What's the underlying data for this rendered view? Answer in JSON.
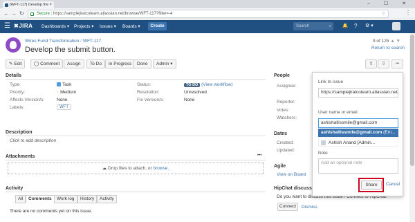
{
  "browser": {
    "tab_title": "[WFT-117] Develop the",
    "tab_close": "×",
    "window_controls": "– ☐ ✕",
    "secure_label": "Secure",
    "url": "https://samplejiratcolearn.atlassian.net/browse/WFT-117?filter=-4",
    "star": "☆",
    "menu": "⋮",
    "back": "←",
    "forward": "→",
    "reload": "↻"
  },
  "topnav": {
    "menu_glyph": "☰",
    "logo": "✖JIRA",
    "items": [
      "Dashboards ▾",
      "Projects ▾",
      "Issues ▾",
      "Boards ▾"
    ],
    "create": "Create",
    "search_placeholder": "Search",
    "search_icon": "⌕",
    "bell": "🔔",
    "help": "?",
    "settings": "⚙ ▾",
    "accent": "#205081"
  },
  "issue": {
    "project": "Wires Fund Transformation",
    "separator": "/",
    "key": "WFT-117",
    "summary": "Develop the submit button.",
    "pager": "9 of 125",
    "pager_arrows": "▲ ▼",
    "return_link": "Return to search"
  },
  "toolbar": {
    "edit": "✎ Edit",
    "comment": "◯ Comment",
    "assign": "Assign",
    "todo": "To Do",
    "in_progress": "In Progress",
    "done": "Done",
    "admin": "Admin ▾",
    "share_icon": "⇪",
    "export_icon": "⇩",
    "more_icon": "•••"
  },
  "details": {
    "heading": "Details",
    "type_label": "Type:",
    "type_value": "Task",
    "priority_label": "Priority:",
    "priority_value": "Medium",
    "priority_icon": "↑",
    "affects_label": "Affects Version/s:",
    "affects_value": "None",
    "labels_label": "Labels:",
    "labels_value": "WFT",
    "status_label": "Status:",
    "status_value": "TO DO",
    "workflow_link": "(View workflow)",
    "resolution_label": "Resolution:",
    "resolution_value": "Unresolved",
    "fix_label": "Fix Version/s:",
    "fix_value": "None"
  },
  "description": {
    "heading": "Description",
    "placeholder": "Click to add description"
  },
  "attachments": {
    "heading": "Attachments",
    "more": "•••",
    "drop_text": "Drop files to attach, or",
    "browse": "browse."
  },
  "activity": {
    "heading": "Activity",
    "tabs": [
      "All",
      "Comments",
      "Work log",
      "History",
      "Activity"
    ],
    "active_tab": "Comments",
    "empty": "There are no comments yet on this issue."
  },
  "people": {
    "heading": "People",
    "assignee_label": "Assignee:",
    "reporter_label": "Reporter:",
    "votes_label": "Votes:",
    "watchers_label": "Watchers:"
  },
  "dates": {
    "heading": "Dates",
    "created_label": "Created:",
    "updated_label": "Updated:"
  },
  "agile": {
    "heading": "Agile",
    "link": "View on Board"
  },
  "hipchat": {
    "heading": "HipChat discussio",
    "text": "Do you want to discuss this issue? Connect to HipChat.",
    "connect": "Connect",
    "dismiss": "Dismiss"
  },
  "share_popup": {
    "link_label": "Link to issue",
    "link_value": "https://samplejiratcolearn.atlassian.net/b",
    "user_label": "User name or email",
    "user_value": "ashishallissmile@gmail.com",
    "suggestion_1_bold": "ashishallissmile@gmail.com",
    "suggestion_1_rest": " (Em...",
    "suggestion_2": "Ashish Anand [Admin...",
    "note_label": "Note",
    "note_placeholder": "Add an optional note",
    "share_button": "Share",
    "cancel": "Cancel",
    "highlight_color": "#d0021b"
  }
}
